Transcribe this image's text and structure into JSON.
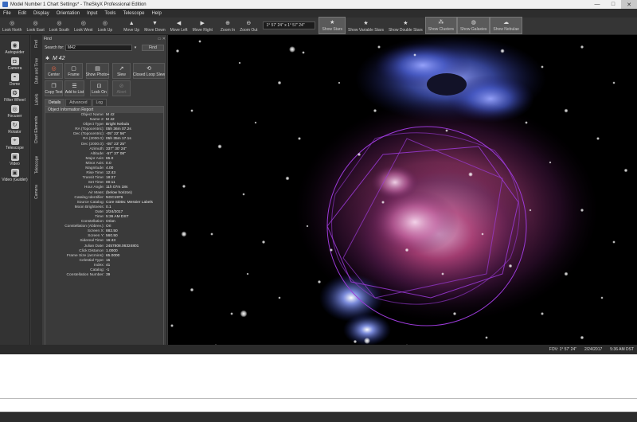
{
  "window": {
    "title": "Model Number 1 Chart Settings* - TheSkyX Professional Edition",
    "buttons": {
      "minimize": "—",
      "maximize": "□",
      "close": "✕"
    }
  },
  "menu": [
    "File",
    "Edit",
    "Display",
    "Orientation",
    "Input",
    "Tools",
    "Telescope",
    "Help"
  ],
  "toolbar": {
    "look": [
      {
        "label": "Look North",
        "icon": "compass-icon"
      },
      {
        "label": "Look East",
        "icon": "compass-icon"
      },
      {
        "label": "Look South",
        "icon": "compass-icon"
      },
      {
        "label": "Look West",
        "icon": "compass-icon"
      },
      {
        "label": "Look Up",
        "icon": "compass-icon"
      }
    ],
    "move": [
      {
        "label": "Move Up",
        "icon": "arrow-up-icon"
      },
      {
        "label": "Move Down",
        "icon": "arrow-down-icon"
      },
      {
        "label": "Move Left",
        "icon": "arrow-left-icon"
      },
      {
        "label": "Move Right",
        "icon": "arrow-right-icon"
      }
    ],
    "zoom": [
      {
        "label": "Zoom In",
        "icon": "zoom-in-icon"
      },
      {
        "label": "Zoom Out",
        "icon": "zoom-out-icon"
      }
    ],
    "fov_value": "1° 57' 24\" x 1° 57' 24\"",
    "show": [
      {
        "label": "Show Stars",
        "icon": "star-icon",
        "toggled": true
      },
      {
        "label": "Show Variable Stars",
        "icon": "star-icon",
        "toggled": false
      },
      {
        "label": "Show Double Stars",
        "icon": "star-icon",
        "toggled": false
      },
      {
        "label": "Show Clusters",
        "icon": "cluster-icon",
        "toggled": true
      },
      {
        "label": "Show Galaxies",
        "icon": "galaxy-icon",
        "toggled": true
      },
      {
        "label": "Show Nebulae",
        "icon": "nebula-icon",
        "toggled": true
      }
    ]
  },
  "left_tools": [
    {
      "label": "Autoguider",
      "icon": "autoguider-icon"
    },
    {
      "label": "Camera",
      "icon": "camera-icon"
    },
    {
      "label": "Dome",
      "icon": "dome-icon"
    },
    {
      "label": "Filter Wheel",
      "icon": "filter-wheel-icon"
    },
    {
      "label": "Focuser",
      "icon": "focuser-icon"
    },
    {
      "label": "Rotator",
      "icon": "rotator-icon"
    },
    {
      "label": "Telescope",
      "icon": "telescope-icon"
    },
    {
      "label": "Video",
      "icon": "video-icon"
    },
    {
      "label": "Video (Guider)",
      "icon": "video-guider-icon"
    }
  ],
  "side_tabs": [
    "Find",
    "Date and Time",
    "Labels",
    "Chart Elements",
    "Telescope",
    "Camera"
  ],
  "find": {
    "header": "Find",
    "search_label": "Search for:",
    "search_value": "M42",
    "find_button": "Find",
    "object_name": "M 42",
    "actions": [
      {
        "label": "Center",
        "icon": "target-icon",
        "enabled": true
      },
      {
        "label": "Frame",
        "icon": "frame-icon",
        "enabled": true
      },
      {
        "label": "Show Photo+",
        "icon": "photo-icon",
        "enabled": true
      },
      {
        "label": "Slew",
        "icon": "slew-icon",
        "enabled": true
      },
      {
        "label": "Closed Loop Slew",
        "icon": "closed-loop-icon",
        "enabled": true
      },
      {
        "label": "Copy Text",
        "icon": "copy-icon",
        "enabled": true
      },
      {
        "label": "Add to List",
        "icon": "add-list-icon",
        "enabled": true
      },
      {
        "label": "Lock On",
        "icon": "lock-icon",
        "enabled": true
      },
      {
        "label": "Abort",
        "icon": "abort-icon",
        "enabled": false
      }
    ],
    "tabs": [
      {
        "label": "Details",
        "active": true
      },
      {
        "label": "Advanced",
        "active": false
      },
      {
        "label": "Log",
        "active": false
      }
    ],
    "report_title": "Object Information Report",
    "report": [
      {
        "k": "Object Name:",
        "v": "M 42"
      },
      {
        "k": "Name 2:",
        "v": "M 42"
      },
      {
        "k": "Object Type:",
        "v": "Bright Nebula"
      },
      {
        "k": "RA (Topocentric):",
        "v": "05h 36m 07.2s"
      },
      {
        "k": "Dec (Topocentric):",
        "v": "-05° 22' 56\""
      },
      {
        "k": "RA (2000.0):",
        "v": "05h 35m 17.1s"
      },
      {
        "k": "Dec (2000.0):",
        "v": "-05° 23' 25\""
      },
      {
        "k": "Azimuth:",
        "v": "337° 30' 24\""
      },
      {
        "k": "Altitude:",
        "v": "-57° 37' 08\""
      },
      {
        "k": "Major Axis:",
        "v": "65.0"
      },
      {
        "k": "Minor Axis:",
        "v": "0.0"
      },
      {
        "k": "Magnitude:",
        "v": "4.00"
      },
      {
        "k": "Rise Time:",
        "v": "12:43"
      },
      {
        "k": "Transit Time:",
        "v": "18:27"
      },
      {
        "k": "Set Time:",
        "v": "00:11"
      },
      {
        "k": "Hour Angle:",
        "v": "11h 07m 18s"
      },
      {
        "k": "Air Mass:",
        "v": "(below horizon)"
      },
      {
        "k": "Catalog Identifier:",
        "v": "NGC1976"
      },
      {
        "k": "Source Catalog:",
        "v": "Core SDBs: Messier Labels"
      },
      {
        "k": "Moon Brightness:",
        "v": "0.1"
      },
      {
        "k": "Date:",
        "v": "2/24/2017"
      },
      {
        "k": "Time:",
        "v": "5:36 AM DST"
      },
      {
        "k": "Constellation:",
        "v": "Orion"
      },
      {
        "k": "Constellation (Abbrev.):",
        "v": "Ori"
      },
      {
        "k": "Screen X:",
        "v": "882.50"
      },
      {
        "k": "Screen Y:",
        "v": "560.50"
      },
      {
        "k": "Sidereal Time:",
        "v": "16:43"
      },
      {
        "k": "Julian Date:",
        "v": "2457808.06324801"
      },
      {
        "k": "Click Distance:",
        "v": "1.0000"
      },
      {
        "k": "Frame Size (arcmins):",
        "v": "65.0000"
      },
      {
        "k": "Celestial Type:",
        "v": "15"
      },
      {
        "k": "Index:",
        "v": "41"
      },
      {
        "k": "Catalog:",
        "v": "-1"
      },
      {
        "k": "Constellation Number:",
        "v": "39"
      }
    ]
  },
  "status": {
    "fov": "FOV: 1° 57' 24\"",
    "date": "2/24/2017",
    "time": "5:36 AM DST"
  },
  "colors": {
    "nebula_blue": "#4a5ed0",
    "nebula_magenta": "#b0427a",
    "overlay_purple": "#9b3ad8"
  }
}
